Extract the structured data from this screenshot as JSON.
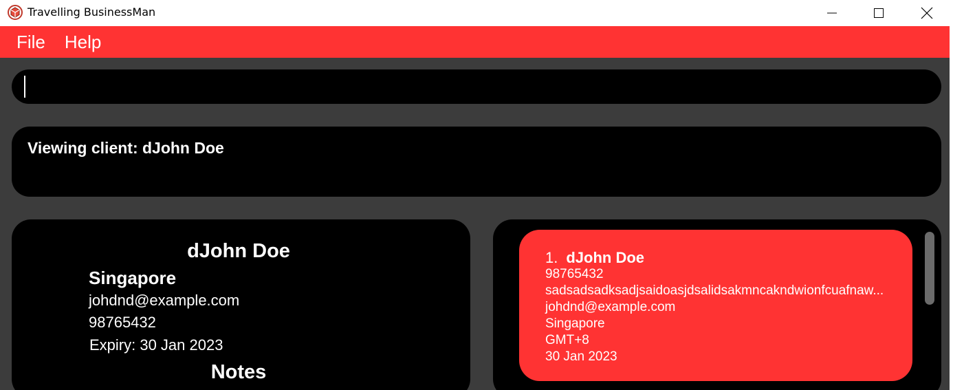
{
  "window": {
    "title": "Travelling BusinessMan",
    "accent_color": "#ff3333",
    "icon": "cube-logo-icon"
  },
  "menu": {
    "items": [
      {
        "label": "File"
      },
      {
        "label": "Help"
      }
    ]
  },
  "command": {
    "value": "",
    "placeholder": ""
  },
  "result": {
    "text": "Viewing client: dJohn Doe"
  },
  "detail": {
    "name": "dJohn Doe",
    "location": "Singapore",
    "email": "johdnd@example.com",
    "phone": "98765432",
    "expiry": "Expiry: 30 Jan 2023",
    "notes_heading": "Notes"
  },
  "client_list": {
    "items": [
      {
        "index": "1.",
        "name": "dJohn Doe",
        "phone": "98765432",
        "note": "sadsadsadksadjsaidoasjdsalidsakmncakndwionfcuafnaw...",
        "email": "johdnd@example.com",
        "location": "Singapore",
        "timezone": "GMT+8",
        "expiry": "30 Jan 2023"
      }
    ]
  }
}
